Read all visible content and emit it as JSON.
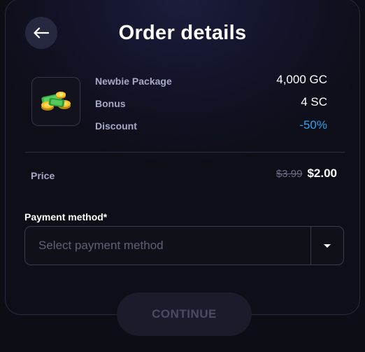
{
  "header": {
    "title": "Order details",
    "back_icon": "arrow-left-icon"
  },
  "package": {
    "icon": "coins-stack-icon",
    "rows": [
      {
        "label": "Newbie Package",
        "value": "4,000 GC"
      },
      {
        "label": "Bonus",
        "value": "4 SC"
      },
      {
        "label": "Discount",
        "value": "-50%"
      }
    ]
  },
  "price": {
    "label": "Price",
    "original": "$3.99",
    "current": "$2.00"
  },
  "payment": {
    "label": "Payment method*",
    "placeholder": "Select payment method",
    "caret_icon": "caret-down-icon"
  },
  "footer": {
    "continue_label": "CONTINUE"
  },
  "colors": {
    "discount": "#2ba3ee",
    "background": "#0d0d16",
    "muted_text": "#a7a8c8"
  }
}
